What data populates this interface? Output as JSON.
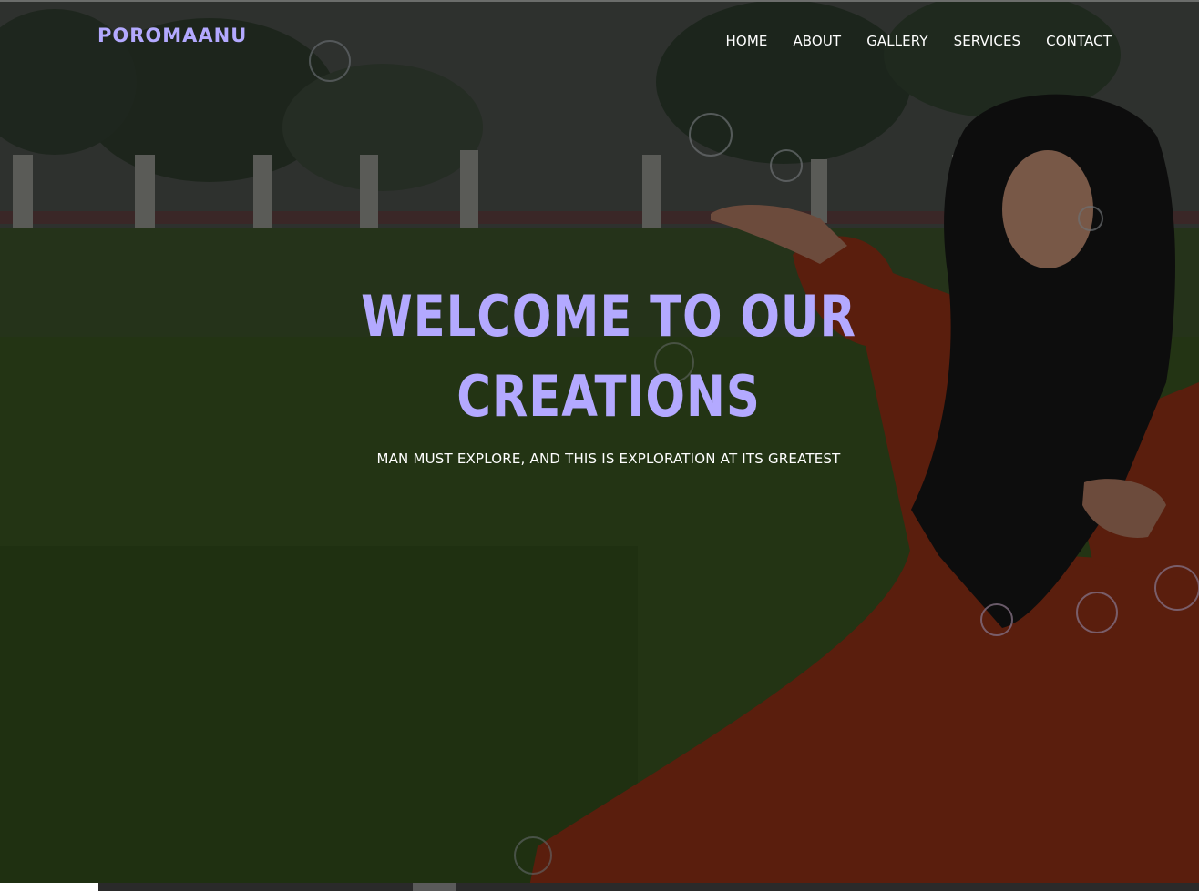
{
  "brand": {
    "name": "POROMAANU"
  },
  "nav": {
    "items": [
      {
        "label": "HOME"
      },
      {
        "label": "ABOUT"
      },
      {
        "label": "GALLERY"
      },
      {
        "label": "SERVICES"
      },
      {
        "label": "CONTACT"
      }
    ]
  },
  "hero": {
    "headline_line1": "WELCOME TO OUR",
    "headline_line2": "CREATIONS",
    "subheadline": "MAN MUST EXPLORE, AND THIS IS EXPLORATION AT ITS GREATEST"
  },
  "colors": {
    "accent": "#b3a9ff",
    "nav_text": "#ffffff",
    "overlay": "#000000"
  }
}
